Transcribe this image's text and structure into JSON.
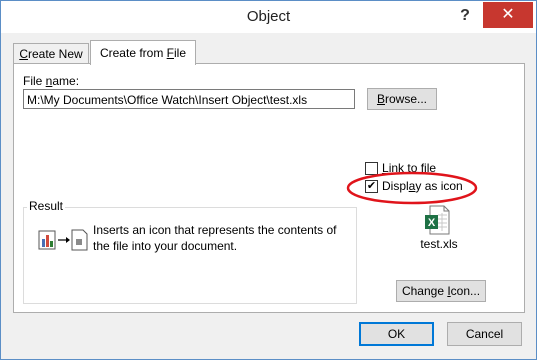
{
  "window": {
    "title": "Object",
    "help_glyph": "?",
    "close_glyph": "✕"
  },
  "tabs": [
    {
      "label_pre": "",
      "label_u": "C",
      "label_post": "reate New"
    },
    {
      "label_pre": "Create from ",
      "label_u": "F",
      "label_post": "ile"
    }
  ],
  "file": {
    "label_pre": "File ",
    "label_u": "n",
    "label_post": "ame:",
    "value": "M:\\My Documents\\Office Watch\\Insert Object\\test.xls",
    "browse_pre": "",
    "browse_u": "B",
    "browse_post": "rowse..."
  },
  "options": {
    "link_pre": "",
    "link_u": "L",
    "link_post": "ink to file",
    "link_checked": false,
    "display_pre": "Displ",
    "display_u": "a",
    "display_post": "y as icon",
    "display_checked": true,
    "check_glyph": "✔"
  },
  "result": {
    "label": "Result",
    "text": "Inserts an icon that represents the contents of the file into your document."
  },
  "icon_preview": {
    "caption": "test.xls",
    "badge": "X",
    "change_pre": "Change ",
    "change_u": "I",
    "change_post": "con..."
  },
  "buttons": {
    "ok": "OK",
    "cancel": "Cancel"
  },
  "colors": {
    "highlight_ellipse": "#e0141b",
    "excel_green": "#1e7145"
  }
}
